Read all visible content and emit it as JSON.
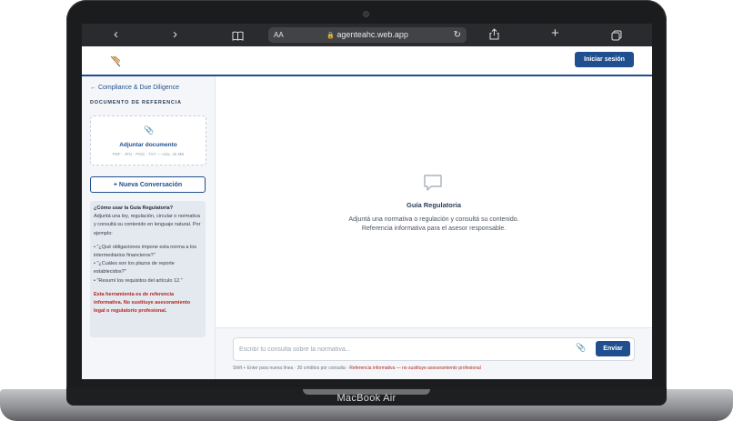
{
  "device": {
    "brand": "MacBook Air"
  },
  "browser": {
    "address_text_size": "AA",
    "url": "agenteahc.web.app",
    "back_icon": "chevron-left-icon",
    "forward_icon": "chevron-right-icon",
    "bookmarks_icon": "book-icon",
    "share_icon": "share-icon",
    "new_tab_icon": "plus-icon",
    "tabs_icon": "tabs-icon",
    "reload_icon": "reload-icon",
    "lock_icon": "lock-icon"
  },
  "header": {
    "login_label": "Iniciar sesión"
  },
  "sidebar": {
    "back_link": "← Compliance & Due Diligence",
    "section_title": "DOCUMENTO DE REFERENCIA",
    "upload_title": "Adjuntar documento",
    "upload_hint": "PDF · JPG · PNG · TXT — máx. 25 MB",
    "new_conversation": "+ Nueva Conversación",
    "help_title": "¿Cómo usar la Guía Regulatoria?",
    "help_body": "Adjuntá una ley, regulación, circular o normativa y consultá su contenido en lenguaje natural. Por ejemplo:",
    "examples": [
      "• \"¿Qué obligaciones impone esta norma a los intermediarios financieros?\"",
      "• \"¿Cuáles son los plazos de reporte establecidos?\"",
      "• \"Resumí los requisitos del artículo 12.\""
    ],
    "warning": "Esta herramienta es de referencia informativa. No sustituye asesoramiento legal o regulatorio profesional."
  },
  "main": {
    "empty_title": "Guía Regulatoria",
    "empty_line1": "Adjuntá una normativa o regulación y consultá su contenido.",
    "empty_line2": "Referencia informativa para el asesor responsable."
  },
  "composer": {
    "placeholder": "Escribí tu consulta sobre la normativa...",
    "send_label": "Enviar",
    "hint_shortcut": "Shift + Enter para nueva línea",
    "hint_credits": "30 créditos por consulta",
    "hint_disclaimer": "Referencia informativa — no sustituye asesoramiento profesional",
    "separator": "·"
  },
  "colors": {
    "brand": "#1f4f8f",
    "warning": "#b3261e"
  }
}
